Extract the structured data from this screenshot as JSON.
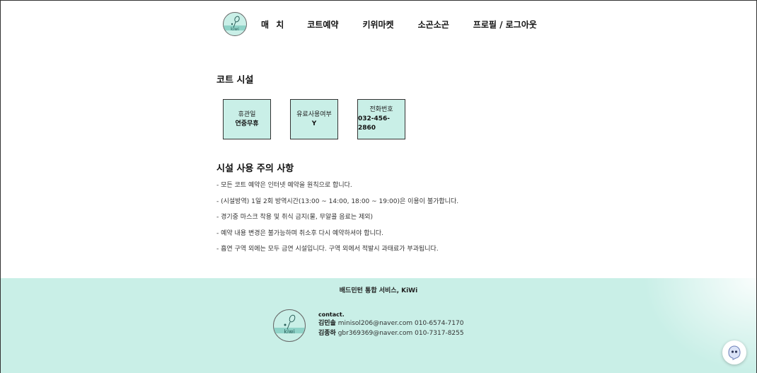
{
  "nav": {
    "logo_text": "kiwi",
    "items": [
      "매 치",
      "코트예약",
      "키위마켓",
      "소곤소곤",
      "프로필 / 로그아웃"
    ]
  },
  "facility": {
    "title": "코트 시설",
    "cards": [
      {
        "label": "휴관일",
        "value": "연중무휴"
      },
      {
        "label": "유료사용여부",
        "value": "Y"
      },
      {
        "label": "전화번호",
        "value": "032-456-2860"
      }
    ]
  },
  "notices": {
    "title": "시설 사용 주의 사항",
    "items": [
      "- 모든 코트 예약은 인터넷 예약을 원칙으로 합니다.",
      "- (시설방역) 1일 2회 방역시간(13:00 ~ 14:00, 18:00 ~ 19:00)은 이용이 불가합니다.",
      "- 경기중 마스크 착용 및 취식 금지(물, 무알콜 음료는 제외)",
      "- 예약 내용 변경은 불가능하며 취소후 다시 예약하셔야 합니다.",
      "- 흡연 구역 외에는 모두 금연 시설입니다. 구역 외에서 적발시 과태료가 부과됩니다."
    ]
  },
  "footer": {
    "title": "배드민턴 통합 서비스, KiWi",
    "logo_text": "kiwi",
    "contact_label": "contact.",
    "contacts": [
      {
        "name": "김민솔",
        "email": "minisol206@naver.com",
        "phone": "010-6574-7170"
      },
      {
        "name": "김종하",
        "email": "gbr369369@naver.com",
        "phone": "010-7317-8255"
      }
    ]
  },
  "colors": {
    "mint": "#c9efe7",
    "logo_accent": "#5aa9a0"
  },
  "icons": {
    "logo": "badminton-racket-icon",
    "chat": "chat-ghost-icon"
  }
}
